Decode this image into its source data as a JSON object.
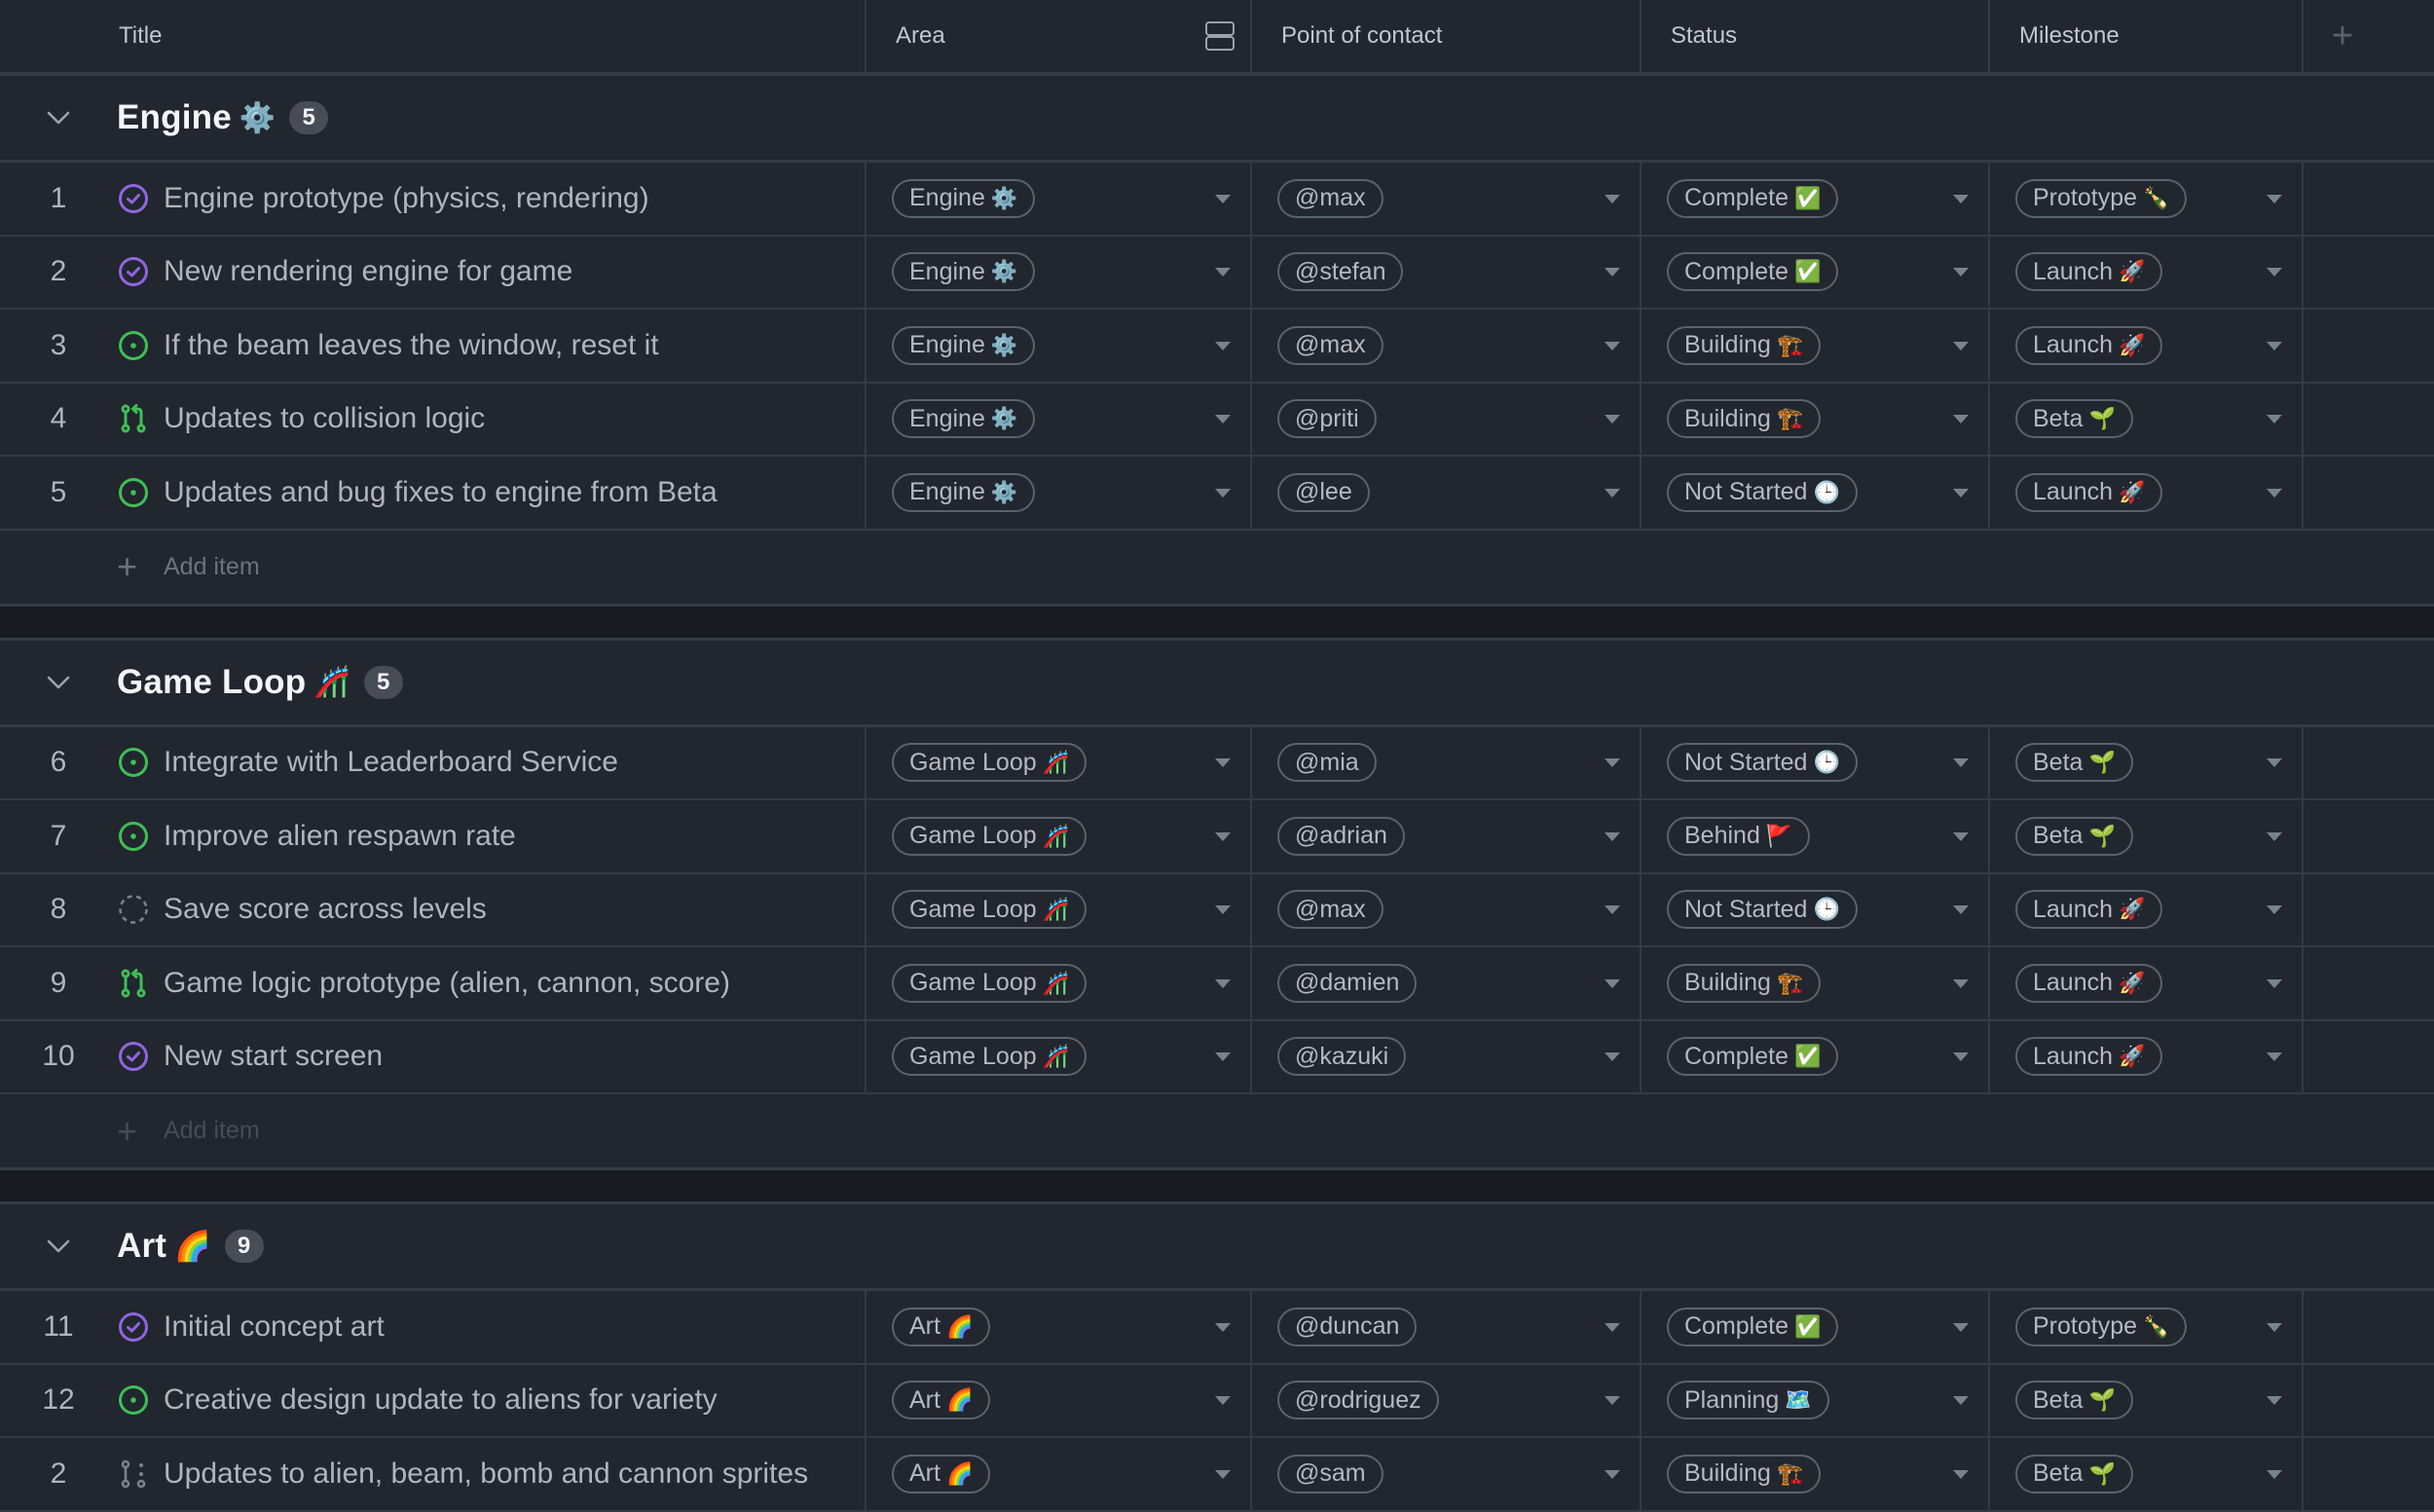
{
  "columns": {
    "title": "Title",
    "area": "Area",
    "point_of_contact": "Point of contact",
    "status": "Status",
    "milestone": "Milestone",
    "add_column_icon": "plus-icon",
    "layout_icon": "row-layout-icon"
  },
  "add_item_label": "Add item",
  "colors": {
    "background": "#22262e",
    "band": "#181b22",
    "border": "#353a44",
    "closed_issue": "#9065e0",
    "open_issue": "#3fbf57",
    "draft": "#6b7280"
  },
  "groups": [
    {
      "name": "Engine",
      "emoji": "⚙️",
      "count": "5",
      "items": [
        {
          "num": "1",
          "icon": "closed-issue",
          "title": "Engine prototype (physics, rendering)",
          "area": "Engine",
          "area_emoji": "⚙️",
          "poc": "@max",
          "status": "Complete",
          "status_emoji": "✅",
          "milestone": "Prototype",
          "milestone_emoji": "🍾"
        },
        {
          "num": "2",
          "icon": "closed-issue",
          "title": "New rendering engine for game",
          "area": "Engine",
          "area_emoji": "⚙️",
          "poc": "@stefan",
          "status": "Complete",
          "status_emoji": "✅",
          "milestone": "Launch",
          "milestone_emoji": "🚀"
        },
        {
          "num": "3",
          "icon": "open-issue",
          "title": "If the beam leaves the window, reset it",
          "area": "Engine",
          "area_emoji": "⚙️",
          "poc": "@max",
          "status": "Building",
          "status_emoji": "🏗️",
          "milestone": "Launch",
          "milestone_emoji": "🚀"
        },
        {
          "num": "4",
          "icon": "pull-request",
          "title": "Updates to collision logic",
          "area": "Engine",
          "area_emoji": "⚙️",
          "poc": "@priti",
          "status": "Building",
          "status_emoji": "🏗️",
          "milestone": "Beta",
          "milestone_emoji": "🌱"
        },
        {
          "num": "5",
          "icon": "open-issue",
          "title": "Updates and bug fixes to engine from Beta",
          "area": "Engine",
          "area_emoji": "⚙️",
          "poc": "@lee",
          "status": "Not Started",
          "status_emoji": "🕒",
          "milestone": "Launch",
          "milestone_emoji": "🚀"
        }
      ]
    },
    {
      "name": "Game Loop",
      "emoji": "🎢",
      "count": "5",
      "items": [
        {
          "num": "6",
          "icon": "open-issue",
          "title": "Integrate with Leaderboard Service",
          "area": "Game Loop",
          "area_emoji": "🎢",
          "poc": "@mia",
          "status": "Not Started",
          "status_emoji": "🕒",
          "milestone": "Beta",
          "milestone_emoji": "🌱"
        },
        {
          "num": "7",
          "icon": "open-issue",
          "title": "Improve alien respawn rate",
          "area": "Game Loop",
          "area_emoji": "🎢",
          "poc": "@adrian",
          "status": "Behind",
          "status_emoji": "🚩",
          "milestone": "Beta",
          "milestone_emoji": "🌱"
        },
        {
          "num": "8",
          "icon": "draft-issue",
          "title": "Save score across levels",
          "area": "Game Loop",
          "area_emoji": "🎢",
          "poc": "@max",
          "status": "Not Started",
          "status_emoji": "🕒",
          "milestone": "Launch",
          "milestone_emoji": "🚀"
        },
        {
          "num": "9",
          "icon": "pull-request",
          "title": "Game logic prototype (alien, cannon, score)",
          "area": "Game Loop",
          "area_emoji": "🎢",
          "poc": "@damien",
          "status": "Building",
          "status_emoji": "🏗️",
          "milestone": "Launch",
          "milestone_emoji": "🚀"
        },
        {
          "num": "10",
          "icon": "closed-issue",
          "title": "New start screen",
          "area": "Game Loop",
          "area_emoji": "🎢",
          "poc": "@kazuki",
          "status": "Complete",
          "status_emoji": "✅",
          "milestone": "Launch",
          "milestone_emoji": "🚀"
        }
      ]
    },
    {
      "name": "Art",
      "emoji": "🌈",
      "count": "9",
      "items": [
        {
          "num": "11",
          "icon": "closed-issue",
          "title": "Initial concept art",
          "area": "Art",
          "area_emoji": "🌈",
          "poc": "@duncan",
          "status": "Complete",
          "status_emoji": "✅",
          "milestone": "Prototype",
          "milestone_emoji": "🍾"
        },
        {
          "num": "12",
          "icon": "open-issue",
          "title": "Creative design update to aliens for variety",
          "area": "Art",
          "area_emoji": "🌈",
          "poc": "@rodriguez",
          "status": "Planning",
          "status_emoji": "🗺️",
          "milestone": "Beta",
          "milestone_emoji": "🌱"
        },
        {
          "num": "2",
          "icon": "draft-pull-request",
          "title": "Updates to alien, beam, bomb and cannon sprites",
          "area": "Art",
          "area_emoji": "🌈",
          "poc": "@sam",
          "status": "Building",
          "status_emoji": "🏗️",
          "milestone": "Beta",
          "milestone_emoji": "🌱"
        }
      ]
    }
  ]
}
